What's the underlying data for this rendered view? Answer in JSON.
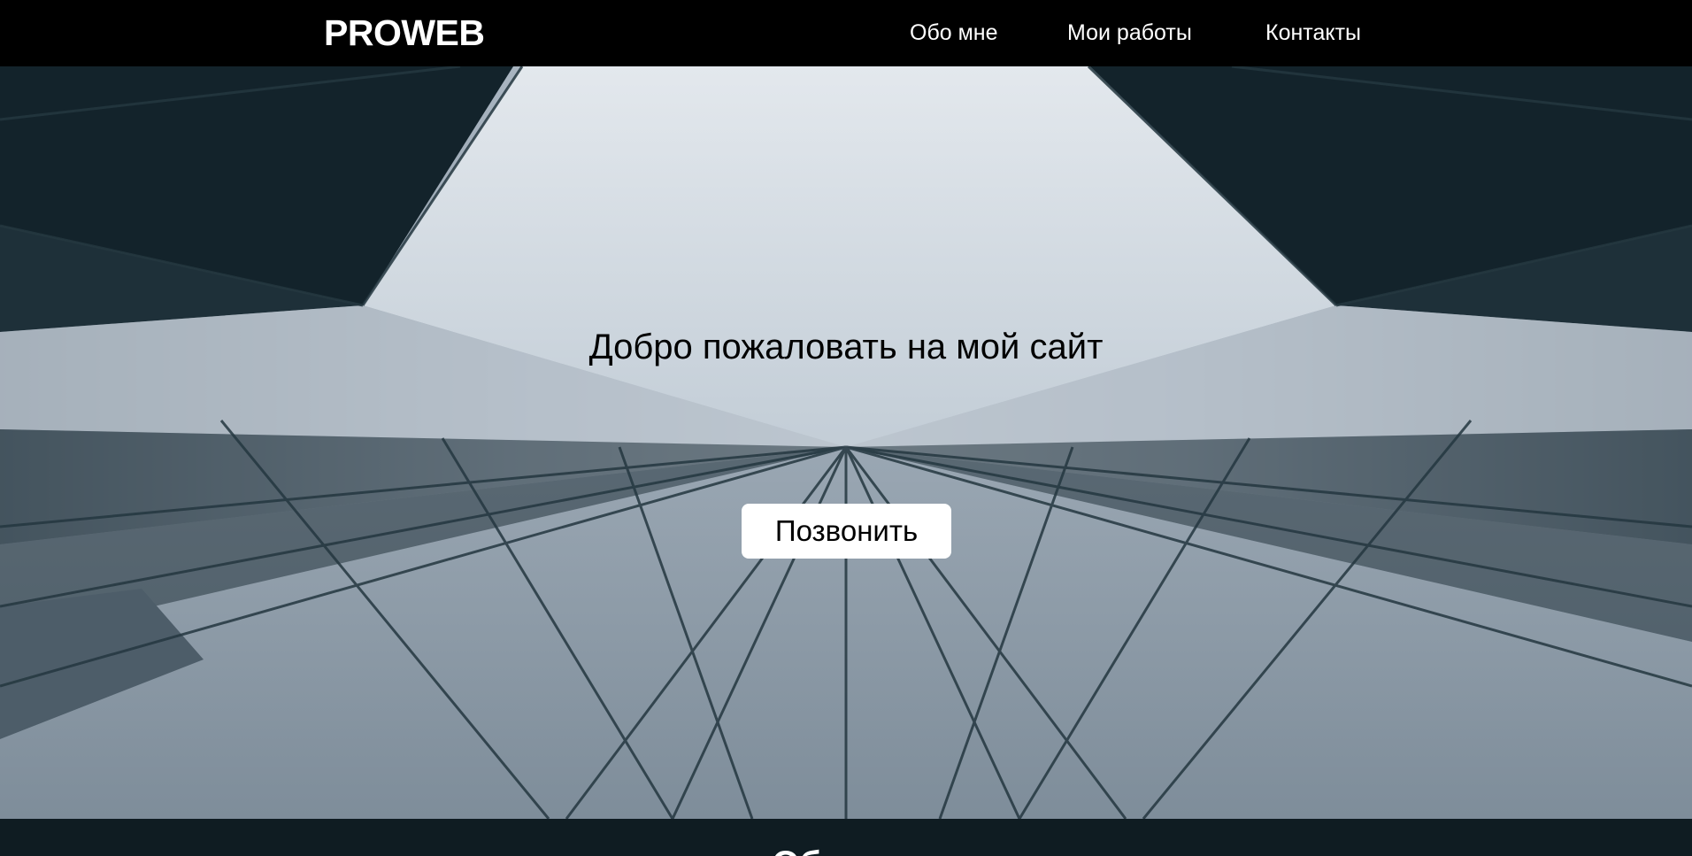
{
  "header": {
    "logo": "PROWEB",
    "nav": [
      {
        "label": "Обо мне"
      },
      {
        "label": "Мои работы"
      },
      {
        "label": "Контакты"
      }
    ]
  },
  "hero": {
    "title": "Добро пожаловать на мой сайт",
    "button_label": "Позвонить"
  },
  "next_section": {
    "heading": "Обо мне"
  },
  "colors": {
    "header_bg": "#000000",
    "hero_sky": "#c9d3dc",
    "building_dark": "#0e1c22",
    "footer_bg": "#0f1c22",
    "button_bg": "#ffffff"
  }
}
